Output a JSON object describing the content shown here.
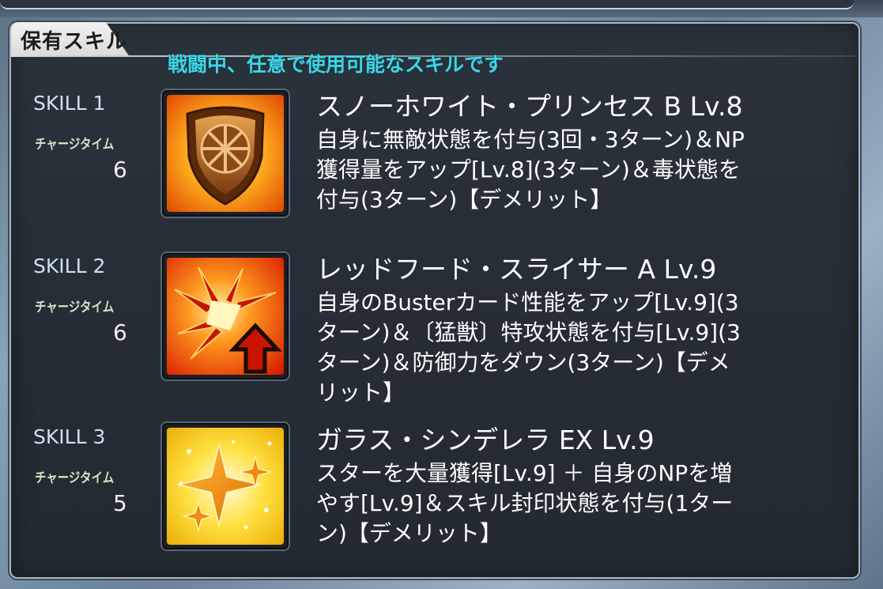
{
  "panel": {
    "tab_title": "保有スキル",
    "subtitle": "戦闘中、任意で使用可能なスキルです"
  },
  "skills": [
    {
      "slot": "SKILL 1",
      "charge_label": "チャージタイム",
      "charge_time": "6",
      "icon": "shield-icon",
      "name": "スノーホワイト・プリンセス B Lv.8",
      "description": "自身に無敵状態を付与(3回・3ターン)＆NP\n獲得量をアップ[Lv.8](3ターン)＆毒状態を\n付与(3ターン)【デメリット】"
    },
    {
      "slot": "SKILL 2",
      "charge_label": "チャージタイム",
      "charge_time": "6",
      "icon": "buster-up-icon",
      "name": "レッドフード・スライサー A Lv.9",
      "description": "自身のBusterカード性能をアップ[Lv.9](3\nターン)＆〔猛獣〕特攻状態を付与[Lv.9](3\nターン)＆防御力をダウン(3ターン)【デメ\nリット】"
    },
    {
      "slot": "SKILL 3",
      "charge_label": "チャージタイム",
      "charge_time": "5",
      "icon": "star-sparkle-icon",
      "name": "ガラス・シンデレラ EX Lv.9",
      "description": "スターを大量獲得[Lv.9] ＋ 自身のNPを増\nやす[Lv.9]＆スキル封印状態を付与(1ター\nン)【デメリット】"
    }
  ],
  "colors": {
    "subtitle": "#3fd4e4",
    "panel_bg": "#252c35",
    "text": "#ffffff"
  }
}
